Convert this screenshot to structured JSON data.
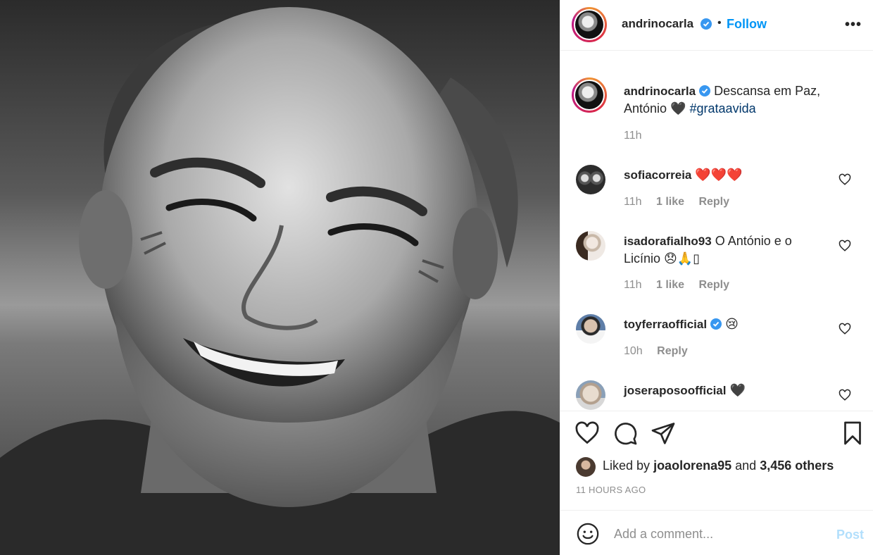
{
  "post": {
    "author": "andrinocarla",
    "follow_dot": "•",
    "follow_label": "Follow",
    "more_label": "•••",
    "caption_part1": "Descansa em Paz,",
    "caption_part2": "António",
    "caption_heart": "🖤",
    "hashtag": "#grataavida",
    "caption_time": "11h",
    "likes_prefix": "Liked by",
    "liked_by_user": "joaolorena95",
    "likes_and": "and",
    "likes_others": "3,456 others",
    "timestamp": "11 HOURS AGO"
  },
  "comments": [
    {
      "user": "sofiacorreia",
      "text": "❤️❤️❤️",
      "time": "11h",
      "likes": "1 like",
      "reply": "Reply"
    },
    {
      "user": "isadorafialho93",
      "text": "O António e o",
      "text2": "Licínio 😞🙏▯",
      "time": "11h",
      "likes": "1 like",
      "reply": "Reply"
    },
    {
      "user": "toyferraofficial",
      "text": "😢",
      "time": "10h",
      "reply": "Reply"
    },
    {
      "user": "joseraposoofficial",
      "text": "🖤"
    }
  ],
  "add_comment": {
    "placeholder": "Add a comment...",
    "post_label": "Post"
  },
  "icons": [
    "verified-badge-icon",
    "heart-icon",
    "comment-icon",
    "share-icon",
    "bookmark-icon",
    "emoji-icon",
    "more-icon"
  ],
  "colors": {
    "accent": "#0095f6",
    "link": "#00376b",
    "muted": "#8e8e8e",
    "post_disabled": "#b2dffc"
  }
}
